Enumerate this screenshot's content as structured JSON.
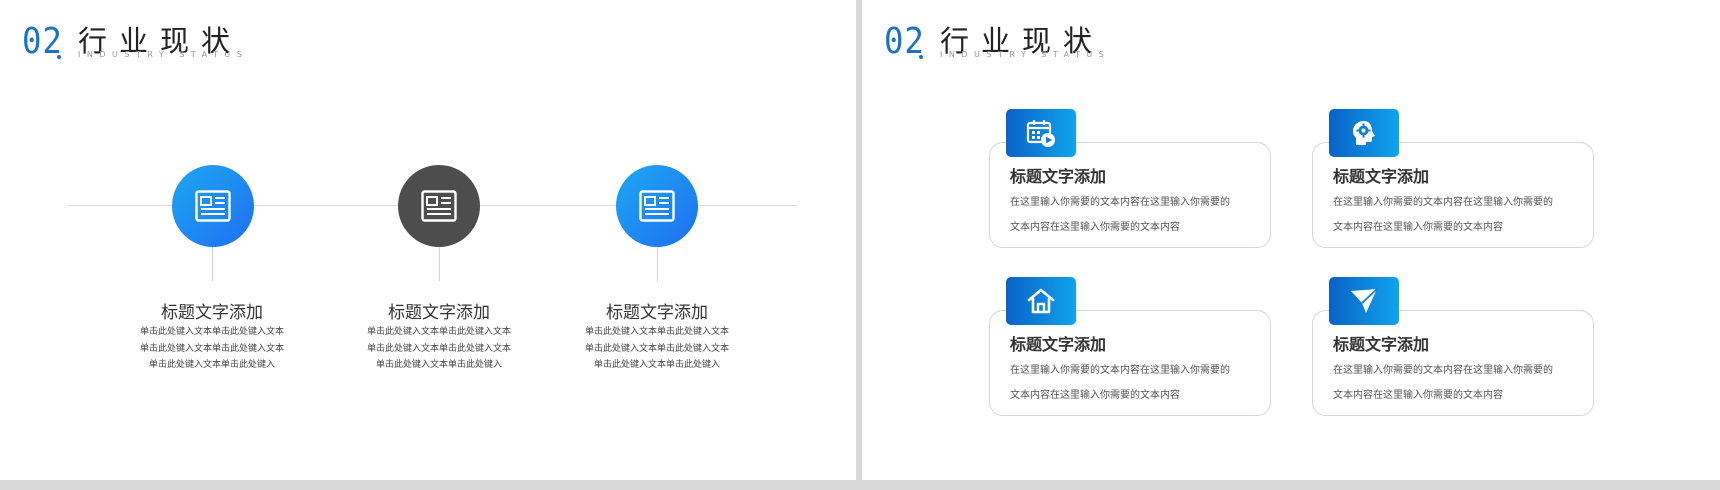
{
  "left": {
    "section_number": "02",
    "section_title": "行业现状",
    "section_subtitle": "INDUSTRY STATUS",
    "items": [
      {
        "title": "标题文字添加",
        "desc": [
          "单击此处键入文本单击此处键入文本",
          "单击此处键入文本单击此处键入文本",
          "单击此处键入文本单击此处键入"
        ],
        "icon": "newspaper-icon",
        "style": "blue"
      },
      {
        "title": "标题文字添加",
        "desc": [
          "单击此处键入文本单击此处键入文本",
          "单击此处键入文本单击此处键入文本",
          "单击此处键入文本单击此处键入"
        ],
        "icon": "newspaper-icon",
        "style": "dark"
      },
      {
        "title": "标题文字添加",
        "desc": [
          "单击此处键入文本单击此处键入文本",
          "单击此处键入文本单击此处键入文本",
          "单击此处键入文本单击此处键入"
        ],
        "icon": "newspaper-icon",
        "style": "blue"
      }
    ]
  },
  "right": {
    "section_number": "02",
    "section_title": "行业现状",
    "section_subtitle": "INDUSTRY STATUS",
    "cards": [
      {
        "title": "标题文字添加",
        "desc": [
          "在这里输入你需要的文本内容在这里输入你需要的",
          "文本内容在这里输入你需要的文本内容"
        ],
        "icon": "calendar-play-icon"
      },
      {
        "title": "标题文字添加",
        "desc": [
          "在这里输入你需要的文本内容在这里输入你需要的",
          "文本内容在这里输入你需要的文本内容"
        ],
        "icon": "head-gear-icon"
      },
      {
        "title": "标题文字添加",
        "desc": [
          "在这里输入你需要的文本内容在这里输入你需要的",
          "文本内容在这里输入你需要的文本内容"
        ],
        "icon": "home-icon"
      },
      {
        "title": "标题文字添加",
        "desc": [
          "在这里输入你需要的文本内容在这里输入你需要的",
          "文本内容在这里输入你需要的文本内容"
        ],
        "icon": "paper-plane-icon"
      }
    ]
  },
  "colors": {
    "accent": "#1a73c9",
    "circle_blue_start": "#1ea8f2",
    "circle_blue_end": "#1e6ff0",
    "circle_dark": "#4d4d4d",
    "icon_tile_start": "#0a62c6",
    "icon_tile_end": "#11a3ee"
  }
}
